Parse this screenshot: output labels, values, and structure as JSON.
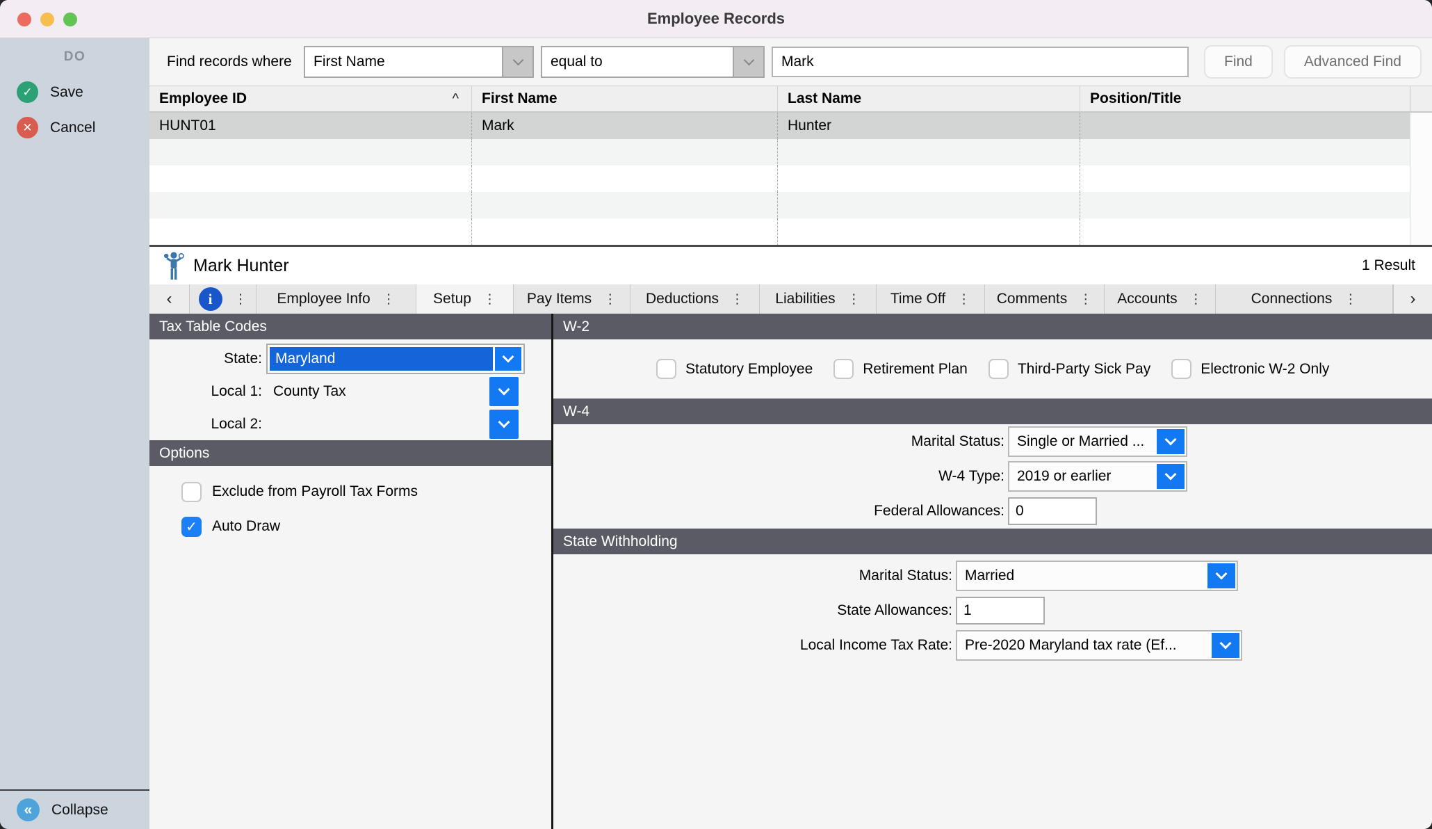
{
  "window": {
    "title": "Employee Records"
  },
  "colors": {
    "titlebar": "#f3edf3",
    "sidebar": "#ccd4de",
    "accent_blue": "#1279f2",
    "selection_blue": "#1465d9",
    "section_header": "#5b5b66",
    "save_green": "#2ba174",
    "cancel_red": "#d85c50",
    "collapse_blue": "#4ea4da",
    "traffic_red": "#ed6a5f",
    "traffic_yellow": "#f6be50",
    "traffic_green": "#61c455"
  },
  "icons": {
    "check": "✓",
    "x": "✕",
    "collapse": "«",
    "back": "‹",
    "forward": "›",
    "menu_dots": "⋮",
    "info": "i",
    "sort_asc": "^"
  },
  "sidebar": {
    "heading": "DO",
    "save_label": "Save",
    "cancel_label": "Cancel",
    "collapse_label": "Collapse"
  },
  "find_bar": {
    "label": "Find records where",
    "field_selected": "First Name",
    "operator_selected": "equal to",
    "search_value": "Mark",
    "find_button": "Find",
    "advanced_find_button": "Advanced Find"
  },
  "results_table": {
    "columns": [
      "Employee ID",
      "First Name",
      "Last Name",
      "Position/Title"
    ],
    "sorted_by": "Employee ID",
    "rows": [
      {
        "employee_id": "HUNT01",
        "first_name": "Mark",
        "last_name": "Hunter",
        "position_title": ""
      }
    ]
  },
  "record_header": {
    "name": "Mark Hunter",
    "result_count": "1 Result"
  },
  "tabs": {
    "items": [
      {
        "label": "Employee Info"
      },
      {
        "label": "Setup",
        "selected": true
      },
      {
        "label": "Pay Items"
      },
      {
        "label": "Deductions"
      },
      {
        "label": "Liabilities"
      },
      {
        "label": "Time Off"
      },
      {
        "label": "Comments"
      },
      {
        "label": "Accounts"
      },
      {
        "label": "Connections"
      }
    ]
  },
  "tax_table_codes": {
    "title": "Tax Table Codes",
    "state_label": "State:",
    "state_value": "Maryland",
    "local1_label": "Local 1:",
    "local1_value": "County Tax",
    "local2_label": "Local 2:",
    "local2_value": ""
  },
  "options": {
    "title": "Options",
    "exclude_label": "Exclude from Payroll Tax Forms",
    "exclude_checked": false,
    "auto_draw_label": "Auto Draw",
    "auto_draw_checked": true
  },
  "w2": {
    "title": "W-2",
    "checkboxes": [
      {
        "label": "Statutory Employee",
        "checked": false
      },
      {
        "label": "Retirement Plan",
        "checked": false
      },
      {
        "label": "Third-Party Sick Pay",
        "checked": false
      },
      {
        "label": "Electronic W-2 Only",
        "checked": false
      }
    ]
  },
  "w4": {
    "title": "W-4",
    "marital_status_label": "Marital Status:",
    "marital_status_value": "Single or Married ...",
    "w4_type_label": "W-4 Type:",
    "w4_type_value": "2019 or earlier",
    "federal_allowances_label": "Federal Allowances:",
    "federal_allowances_value": "0"
  },
  "state_withholding": {
    "title": "State Withholding",
    "marital_status_label": "Marital Status:",
    "marital_status_value": "Married",
    "state_allowances_label": "State Allowances:",
    "state_allowances_value": "1",
    "local_income_tax_rate_label": "Local Income Tax Rate:",
    "local_income_tax_rate_value": "Pre-2020 Maryland tax rate (Ef..."
  }
}
